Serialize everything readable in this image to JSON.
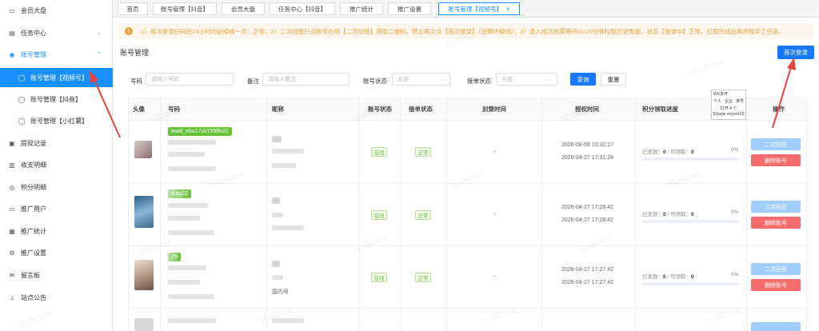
{
  "sidebar": {
    "items": [
      {
        "label": "会员大盘",
        "icon": "dashboard-icon"
      },
      {
        "label": "任务中心",
        "icon": "clipboard-icon",
        "chevron": "⌄"
      },
      {
        "label": "账号管理",
        "icon": "user-icon",
        "chevron": "⌃"
      },
      {
        "label": "账号管理【视频号】",
        "icon": "user-icon"
      },
      {
        "label": "账号管理【抖音】",
        "icon": "user-icon"
      },
      {
        "label": "账号管理【小红薯】",
        "icon": "user-icon"
      },
      {
        "label": "提现记录",
        "icon": "wallet-icon"
      },
      {
        "label": "收支明细",
        "icon": "ledger-icon"
      },
      {
        "label": "积分明细",
        "icon": "points-icon"
      },
      {
        "label": "推广用户",
        "icon": "users-icon"
      },
      {
        "label": "推广统计",
        "icon": "stats-icon"
      },
      {
        "label": "推广设置",
        "icon": "gear-icon"
      },
      {
        "label": "留言板",
        "icon": "mail-icon"
      },
      {
        "label": "站点公告",
        "icon": "bell-icon"
      }
    ]
  },
  "tabs": [
    {
      "label": "首页"
    },
    {
      "label": "账号管理【抖音】"
    },
    {
      "label": "会员大盘"
    },
    {
      "label": "任务中心【抖音】"
    },
    {
      "label": "推广统计"
    },
    {
      "label": "推广设置"
    },
    {
      "label": "账号管理【视频号】",
      "close": "×"
    }
  ],
  "notice": {
    "text": "1）首次登录扫码后24小时内必掉线一次：正常；2）二次回登只点账号右侧【二次回登】获取二维码，禁止再次点【首次登录】（会瞬环掉线）；3）录入成功后需等待10-20分钟拉取历史数据，状态【登录中】正常，拉取完成后再领取手工任务。",
    "icon": "!"
  },
  "page_title": "账号管理",
  "first_login_button": "首次登录",
  "filters": {
    "account_label": "号码",
    "account_placeholder": "请输入号码",
    "remark_label": "备注",
    "remark_placeholder": "请输入备注",
    "account_status_label": "账号状态",
    "account_status_value": "全部",
    "order_status_label": "接单状态",
    "order_status_value": "全部",
    "query_button": "查询",
    "reset_button": "重置"
  },
  "table": {
    "headers": [
      "头像",
      "号码",
      "昵称",
      "账号状态",
      "接单状态",
      "封禁时间",
      "授权时间",
      "积分领取进度",
      "操作"
    ],
    "rows": [
      {
        "tag": "wxid_ebu17ck1599h22",
        "nickname_extra": "",
        "account_status": "在线",
        "order_status": "正常",
        "ban_time": "-",
        "auth_time_1": "2026-08-08 10:32:17",
        "auth_time_2": "2026-04-27 17:31:24",
        "issued_label": "已发放：",
        "issued": "0",
        "claimable_label": " / 可领取：",
        "claimable": "0",
        "pct": "0%",
        "btn_relogin": "二次回登",
        "btn_delete": "删除账号"
      },
      {
        "tag": "tkag22",
        "nickname_extra": "",
        "account_status": "在线",
        "order_status": "正常",
        "ban_time": "-",
        "auth_time_1": "2026-04-27 17:28:42",
        "auth_time_2": "2026-04-27 17:28:42",
        "issued_label": "已发放：",
        "issued": "0",
        "claimable_label": " / 可领取：",
        "claimable": "0",
        "pct": "0%",
        "btn_relogin": "二次回登",
        "btn_delete": "删除账号"
      },
      {
        "tag": "29",
        "nickname_extra": "国内号",
        "account_status": "在线",
        "order_status": "正常",
        "ban_time": "-",
        "auth_time_1": "2026-04-27 17:27:42",
        "auth_time_2": "2026-04-27 17:27:42",
        "issued_label": "已发放：",
        "issued": "0",
        "claimable_label": " / 可领取：",
        "claimable": "0",
        "pct": "0%",
        "btn_relogin": "二次回登",
        "btn_delete": "删除账号"
      }
    ]
  },
  "watermark": "121252154",
  "mini_popup": {
    "title": "WX多开",
    "opt1": "个人",
    "opt2": "企业",
    "opt3": "排号",
    "line1": "打开 4 个",
    "line2": "52pojie xoyun123"
  },
  "colors": {
    "primary": "#1677ff",
    "success": "#67c23a",
    "danger": "#f56c6c",
    "warning": "#e6a23c",
    "annotation": "#e8433a"
  }
}
